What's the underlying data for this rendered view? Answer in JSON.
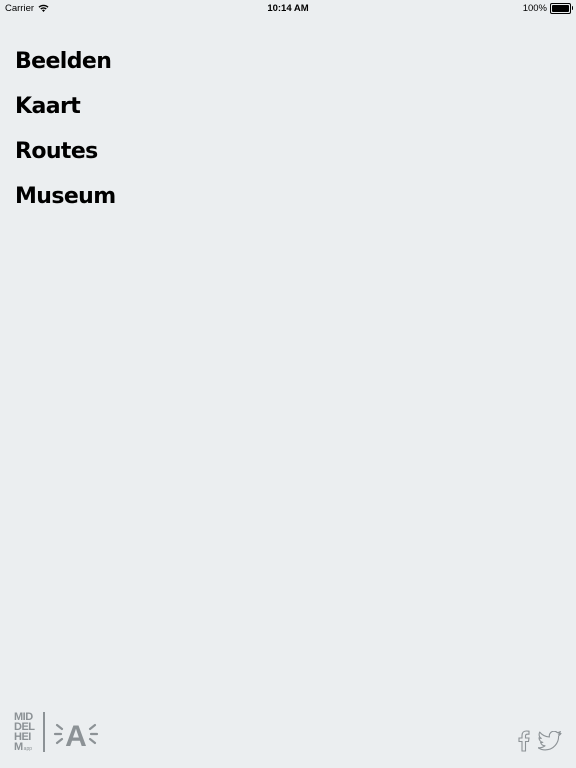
{
  "status_bar": {
    "carrier": "Carrier",
    "time": "10:14 AM",
    "battery": "100%",
    "battery_level": 1.0
  },
  "menu": {
    "items": [
      {
        "label": "Beelden"
      },
      {
        "label": "Kaart"
      },
      {
        "label": "Routes"
      },
      {
        "label": "Museum"
      }
    ]
  },
  "footer": {
    "middelheim_logo": {
      "lines": [
        "MID",
        "DEL",
        "HEI",
        "M"
      ],
      "suffix": "app"
    },
    "antwerp_logo": "A",
    "social_icons": [
      "facebook-icon",
      "twitter-icon"
    ]
  },
  "colors": {
    "background": "#ebeef0",
    "text": "#000000",
    "logo_gray": "#8c9296"
  }
}
